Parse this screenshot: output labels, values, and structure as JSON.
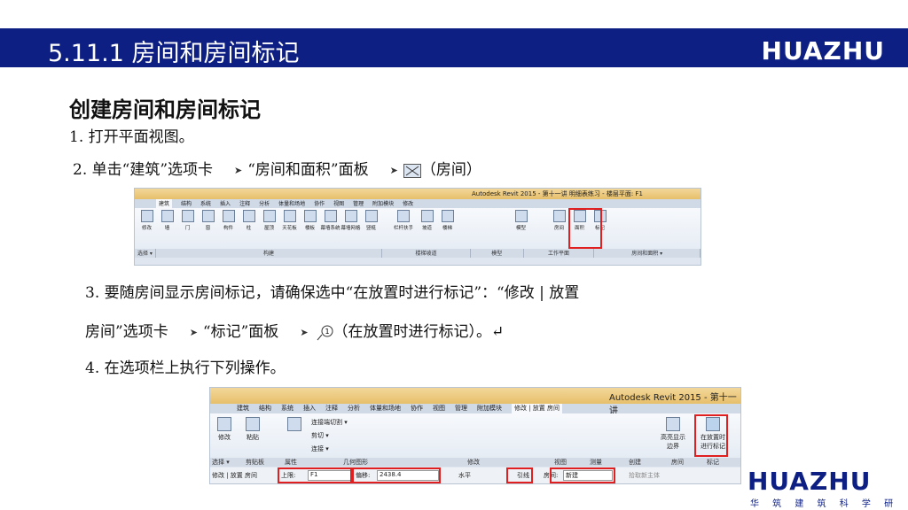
{
  "header": {
    "title": "5.11.1  房间和房间标记",
    "logo": "HUAZHU",
    "colors": {
      "bar": "#0d1f82",
      "highlight": "#e02020"
    }
  },
  "section_title": "创建房间和房间标记",
  "steps": {
    "s1": "1. 打开平面视图。",
    "s2a": "2. 单击“建筑”选项卡",
    "s2b": "“房间和面积”面板",
    "s2c": "（房间）",
    "s3a": "3. 要随房间显示房间标记，请确保选中“在放置时进行标记”：“修改 | 放置",
    "s3b": "房间”选项卡",
    "s3c": "“标记”面板",
    "s3d": "（在放置时进行标记）。↵",
    "s4": "4. 在选项栏上执行下列操作。"
  },
  "ribbon1": {
    "app_title": "Autodesk Revit 2015 -    第十一讲 明细表练习 - 楼层平面: F1",
    "tabs": [
      "建筑",
      "结构",
      "系统",
      "插入",
      "注释",
      "分析",
      "体量和场地",
      "协作",
      "视图",
      "管理",
      "附加模块",
      "修改"
    ],
    "tools": [
      "修改",
      "墙",
      "门",
      "窗",
      "构件",
      "柱",
      "屋顶",
      "天花板",
      "楼板",
      "幕墙系统",
      "幕墙网格",
      "竖梃",
      "栏杆扶手",
      "坡道",
      "楼梯",
      "模型",
      "房间",
      "面积",
      "标记"
    ],
    "panels": [
      "选择 ▾",
      "构建",
      "楼梯坡道",
      "模型",
      "工作平面",
      "房间和面积 ▾"
    ]
  },
  "ribbon2": {
    "app_title": "Autodesk Revit 2015 -   第十一讲",
    "tabs": [
      "建筑",
      "结构",
      "系统",
      "插入",
      "注释",
      "分析",
      "体量和场地",
      "协作",
      "视图",
      "管理",
      "附加模块",
      "修改 | 放置 房间"
    ],
    "tools": {
      "modify": "修改",
      "paste": "粘贴",
      "properties": "属性",
      "join": "连接端切割 ▾",
      "cut": "剪切 ▾",
      "connect": "连接 ▾",
      "highlight_boundary": "高亮显示边界",
      "tag_on_place": "在放置时进行标记"
    },
    "panels": [
      "选择 ▾",
      "剪贴板",
      "属性",
      "几何图形",
      "修改",
      "视图",
      "测量",
      "创建",
      "房间",
      "标记"
    ],
    "options": {
      "context": "修改 | 放置 房间",
      "upper_label": "上限:",
      "upper_value": "F1",
      "offset_label": "偏移:",
      "offset_value": "2438.4",
      "orientation": "水平",
      "lead": "引线",
      "room_label": "房间:",
      "room_value": "新建",
      "load_text": "拾取新主体"
    }
  },
  "footer_logo": {
    "name": "HUAZHU",
    "subtitle": "华 筑 建 筑 科 学 研 究 院"
  }
}
